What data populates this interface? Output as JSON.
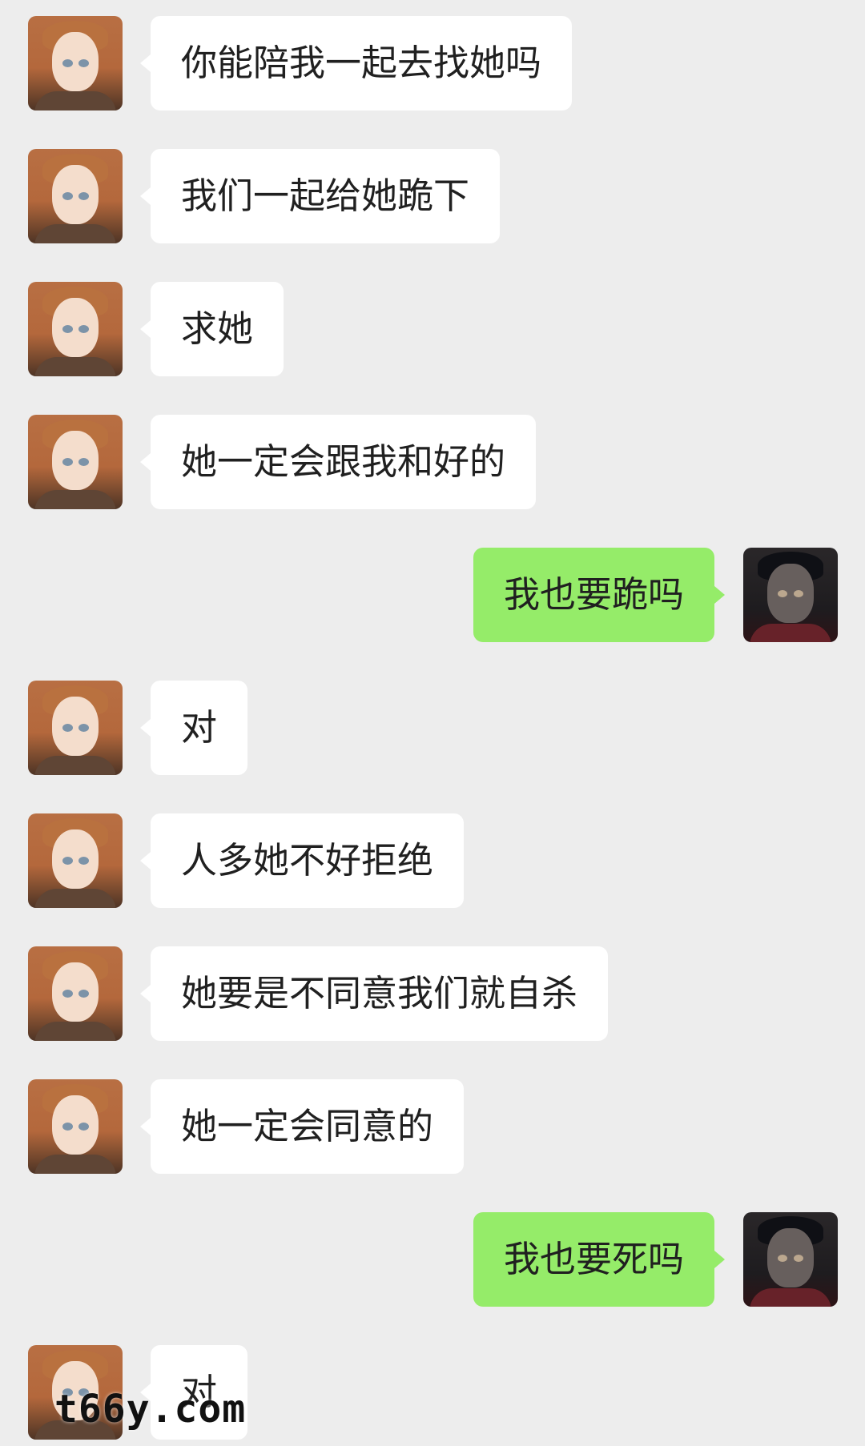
{
  "chat": {
    "messages": [
      {
        "side": "left",
        "avatar": "ginger-haired-avatar",
        "text": "你能陪我一起去找她吗"
      },
      {
        "side": "left",
        "avatar": "ginger-haired-avatar",
        "text": "我们一起给她跪下"
      },
      {
        "side": "left",
        "avatar": "ginger-haired-avatar",
        "text": "求她"
      },
      {
        "side": "left",
        "avatar": "ginger-haired-avatar",
        "text": "她一定会跟我和好的"
      },
      {
        "side": "right",
        "avatar": "dark-haired-avatar",
        "text": "我也要跪吗"
      },
      {
        "side": "left",
        "avatar": "ginger-haired-avatar",
        "text": "对"
      },
      {
        "side": "left",
        "avatar": "ginger-haired-avatar",
        "text": "人多她不好拒绝"
      },
      {
        "side": "left",
        "avatar": "ginger-haired-avatar",
        "text": "她要是不同意我们就自杀"
      },
      {
        "side": "left",
        "avatar": "ginger-haired-avatar",
        "text": "她一定会同意的"
      },
      {
        "side": "right",
        "avatar": "dark-haired-avatar",
        "text": "我也要死吗"
      },
      {
        "side": "left",
        "avatar": "ginger-haired-avatar",
        "text": "对"
      }
    ]
  },
  "watermark": {
    "text": "t66y.com"
  },
  "colors": {
    "background": "#ededed",
    "incoming_bubble": "#ffffff",
    "outgoing_bubble": "#95ec69",
    "text": "#202020"
  }
}
